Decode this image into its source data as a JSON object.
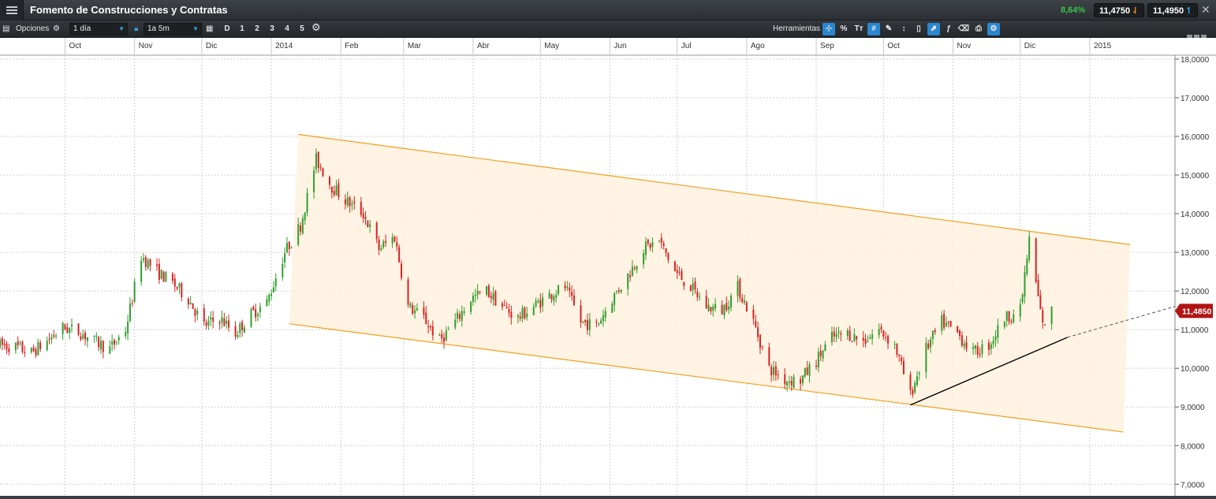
{
  "window": {
    "title": "Fomento de Construcciones y Contratas",
    "change_pct": "8,64%",
    "bid": "11,4750",
    "ask": "11,4950",
    "bid_arrow": "⇃",
    "ask_arrow": "↿",
    "close_glyph": "✕"
  },
  "toolbar": {
    "options_label": "Opciones",
    "interval": "1 día",
    "range": "1a 5m",
    "range_buttons": [
      "D",
      "1",
      "2",
      "3",
      "4",
      "5"
    ],
    "tools_label": "Herramientas",
    "tool_icons": [
      "crosshair-icon",
      "percent-icon",
      "text-icon",
      "grid-icon",
      "pencil-icon",
      "bar-icon",
      "candle-icon",
      "line-chart-icon",
      "indicator-icon",
      "eraser-icon",
      "print-icon",
      "settings-icon"
    ],
    "tool_glyphs": [
      "⊹",
      "%",
      "Tт",
      "#",
      "✎",
      "↕",
      "▯",
      "⬈",
      "ƒ",
      "⌫",
      "⎙",
      "⚙"
    ]
  },
  "colors": {
    "up": "#2f9e2f",
    "down": "#d42424",
    "channel_fill": "#fff1de",
    "channel_line": "#f0a020",
    "trendline": "#000000",
    "price_tag": "#b01414"
  },
  "chart_data": {
    "type": "candlestick",
    "title": "Fomento de Construcciones y Contratas",
    "x_axis_labels": [
      "Oct",
      "Nov",
      "Dic",
      "2014",
      "Feb",
      "Mar",
      "Abr",
      "May",
      "Jun",
      "Jul",
      "Ago",
      "Sep",
      "Oct",
      "Nov",
      "Dic",
      "2015"
    ],
    "y_tick_labels": [
      "18,0000",
      "17,0000",
      "16,0000",
      "15,0000",
      "14,0000",
      "13,0000",
      "12,0000",
      "11,0000",
      "10,0000",
      "9,0000",
      "8,0000",
      "7,0000"
    ],
    "y_ticks": [
      18,
      17,
      16,
      15,
      14,
      13,
      12,
      11,
      10,
      9,
      8,
      7
    ],
    "ylim": [
      6.7,
      18.1
    ],
    "xlim": [
      "2013-09-02",
      "2015-02-08"
    ],
    "grid": true,
    "last_price_label": "11,4850",
    "last_price": 11.485,
    "series_path": [
      [
        "2013-09-02",
        10.6
      ],
      [
        "2013-09-09",
        10.55
      ],
      [
        "2013-09-16",
        10.4
      ],
      [
        "2013-09-23",
        10.7
      ],
      [
        "2013-09-30",
        11.05
      ],
      [
        "2013-10-07",
        10.95
      ],
      [
        "2013-10-14",
        10.7
      ],
      [
        "2013-10-21",
        10.5
      ],
      [
        "2013-10-28",
        11.0
      ],
      [
        "2013-11-04",
        12.9
      ],
      [
        "2013-11-11",
        12.5
      ],
      [
        "2013-11-18",
        12.2
      ],
      [
        "2013-11-25",
        11.8
      ],
      [
        "2013-12-02",
        11.1
      ],
      [
        "2013-12-09",
        11.3
      ],
      [
        "2013-12-16",
        10.9
      ],
      [
        "2013-12-23",
        11.4
      ],
      [
        "2013-12-30",
        11.7
      ],
      [
        "2014-01-07",
        13.0
      ],
      [
        "2014-01-14",
        13.7
      ],
      [
        "2014-01-21",
        15.4
      ],
      [
        "2014-01-28",
        14.7
      ],
      [
        "2014-02-04",
        14.3
      ],
      [
        "2014-02-11",
        14.0
      ],
      [
        "2014-02-18",
        13.1
      ],
      [
        "2014-02-25",
        13.4
      ],
      [
        "2014-03-03",
        11.6
      ],
      [
        "2014-03-10",
        11.3
      ],
      [
        "2014-03-17",
        10.7
      ],
      [
        "2014-03-24",
        11.2
      ],
      [
        "2014-03-31",
        11.8
      ],
      [
        "2014-04-07",
        12.0
      ],
      [
        "2014-04-14",
        11.6
      ],
      [
        "2014-04-21",
        11.3
      ],
      [
        "2014-04-28",
        11.6
      ],
      [
        "2014-05-05",
        11.9
      ],
      [
        "2014-05-12",
        12.1
      ],
      [
        "2014-05-19",
        11.2
      ],
      [
        "2014-05-26",
        11.1
      ],
      [
        "2014-06-02",
        11.8
      ],
      [
        "2014-06-09",
        12.4
      ],
      [
        "2014-06-16",
        13.1
      ],
      [
        "2014-06-23",
        13.3
      ],
      [
        "2014-06-30",
        12.5
      ],
      [
        "2014-07-07",
        12.1
      ],
      [
        "2014-07-14",
        11.6
      ],
      [
        "2014-07-21",
        11.5
      ],
      [
        "2014-07-28",
        12.1
      ],
      [
        "2014-08-04",
        11.2
      ],
      [
        "2014-08-11",
        10.0
      ],
      [
        "2014-08-18",
        9.7
      ],
      [
        "2014-08-25",
        9.7
      ],
      [
        "2014-09-01",
        10.2
      ],
      [
        "2014-09-08",
        10.8
      ],
      [
        "2014-09-15",
        10.9
      ],
      [
        "2014-09-22",
        10.7
      ],
      [
        "2014-09-29",
        11.0
      ],
      [
        "2014-10-06",
        10.6
      ],
      [
        "2014-10-13",
        9.3
      ],
      [
        "2014-10-20",
        10.5
      ],
      [
        "2014-10-27",
        11.2
      ],
      [
        "2014-11-03",
        10.9
      ],
      [
        "2014-11-10",
        10.4
      ],
      [
        "2014-11-17",
        10.6
      ],
      [
        "2014-11-24",
        11.3
      ],
      [
        "2014-12-01",
        11.5
      ],
      [
        "2014-12-05",
        13.3
      ],
      [
        "2014-12-08",
        12.2
      ],
      [
        "2014-12-11",
        11.1
      ],
      [
        "2014-12-15",
        11.48
      ]
    ],
    "annotations": [
      {
        "name": "channel-upper-line",
        "from": [
          "2014-01-13",
          16.05
        ],
        "to": [
          "2015-01-19",
          13.2
        ]
      },
      {
        "name": "channel-lower-line",
        "from": [
          "2014-01-09",
          11.15
        ],
        "to": [
          "2015-01-16",
          8.35
        ]
      },
      {
        "name": "support-trendline",
        "from": [
          "2014-10-13",
          9.05
        ],
        "to": [
          "2014-12-22",
          10.8
        ]
      },
      {
        "name": "support-trendline-extension",
        "from": [
          "2014-12-22",
          10.8
        ],
        "to": [
          "2015-02-08",
          11.6
        ]
      }
    ]
  }
}
